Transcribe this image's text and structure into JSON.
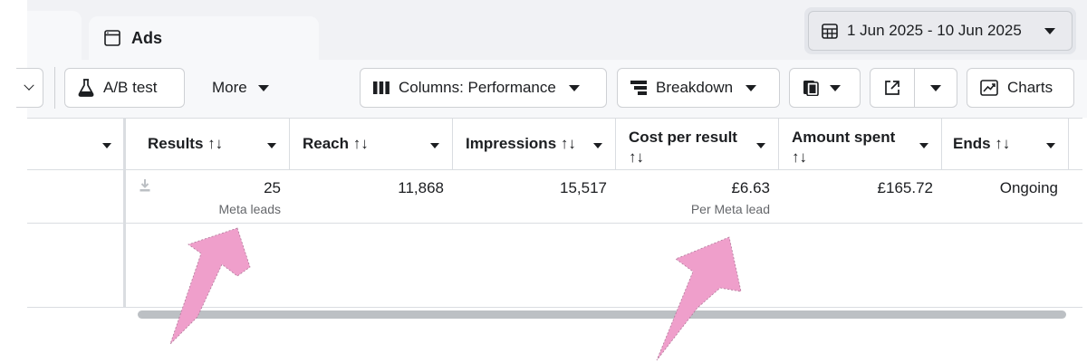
{
  "tabs": {
    "active_label": "Ads"
  },
  "date_range": {
    "label": "1 Jun 2025 - 10 Jun 2025"
  },
  "toolbar": {
    "ab_test_label": "A/B test",
    "more_label": "More",
    "columns_label": "Columns: Performance",
    "breakdown_label": "Breakdown",
    "charts_label": "Charts"
  },
  "table": {
    "headers": {
      "results": "Results ↑↓",
      "reach": "Reach ↑↓",
      "impressions": "Impressions ↑↓",
      "cost_line1": "Cost per result",
      "cost_line2": "↑↓",
      "amount_line1": "Amount spent",
      "amount_line2": "↑↓",
      "ends": "Ends ↑↓"
    },
    "row": {
      "results": "25",
      "results_sub": "Meta leads",
      "reach": "11,868",
      "impressions": "15,517",
      "cost": "£6.63",
      "cost_sub": "Per Meta lead",
      "amount": "£165.72",
      "ends": "Ongoing"
    }
  },
  "icons": {
    "tab": "ad-window-icon",
    "date": "calendar-icon",
    "ab_test": "flask-icon",
    "columns": "columns-icon",
    "breakdown": "breakdown-icon",
    "reports": "report-icon",
    "export": "export-icon",
    "charts": "chart-icon",
    "download": "download-icon"
  },
  "colors": {
    "annotation_arrow": "#ef9fcb"
  }
}
